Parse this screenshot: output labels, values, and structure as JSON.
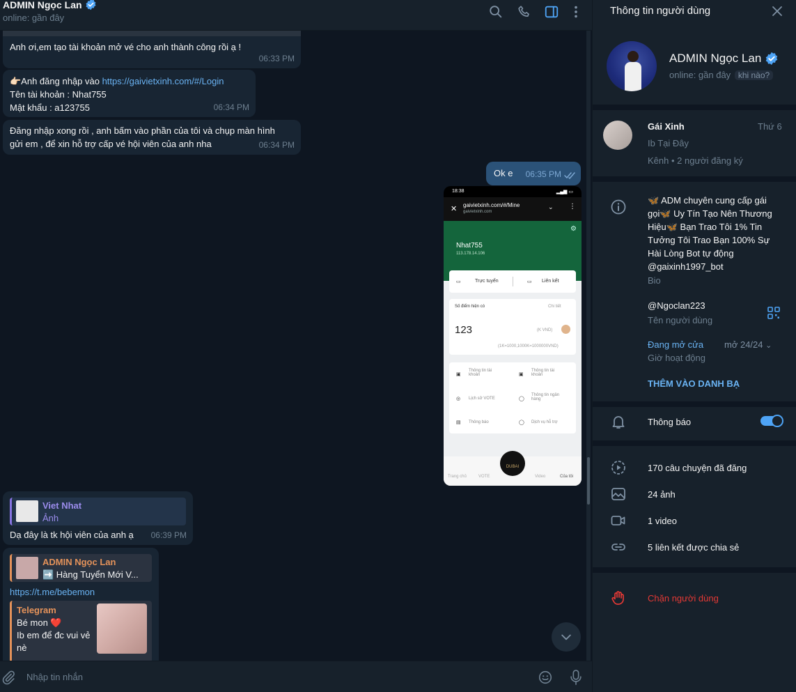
{
  "chat": {
    "title": "ADMIN Ngọc Lan",
    "status": "online: gần đây",
    "composer_placeholder": "Nhập tin nhắn"
  },
  "messages": {
    "m1": {
      "text": "Anh ơi,em tạo tài khoản mở vé cho anh thành công rồi ạ !",
      "time": "06:33 PM"
    },
    "m2": {
      "line1_prefix": "👉🏻Anh đăng nhập vào ",
      "line1_link": "https://gaivietxinh.com/#/Login",
      "line2": "Tên tài khoản : Nhat755",
      "line3": "Mật khẩu : a123755",
      "time": "06:34 PM"
    },
    "m3": {
      "line1": "Đăng nhập xong rồi , anh bấm vào phần của tôi và chụp màn hình",
      "line2": "gửi em , để xin hỗ trợ cấp vé hội viên của anh nha",
      "time": "06:34 PM"
    },
    "m4": {
      "text": "Ok e",
      "time": "06:35 PM"
    },
    "m5": {
      "reply_name": "Viet Nhat",
      "reply_text": "Ảnh",
      "text": "Dạ đây là tk hội viên của anh ạ",
      "time": "06:39 PM"
    },
    "m6": {
      "reply_name": "ADMIN Ngọc Lan",
      "reply_text": "➡️ Hàng Tuyển Mới V...",
      "link": "https://t.me/bebemon",
      "preview_site": "Telegram",
      "preview_title": "Bé mon ❤️",
      "preview_line1": "Ib em để đc vui vẻ",
      "preview_line2": "nè"
    }
  },
  "screenshot": {
    "clock": "18:38",
    "url": "gaivietxinh.com/#/Mine",
    "url_sub": "gaivietxinh.com",
    "username": "Nhat755",
    "ip": "113.178.14.106",
    "tab_online": "Trực tuyến",
    "tab_link": "Liên kết",
    "points_label": "Số điểm hiện có",
    "details": "Chi tiết",
    "points_value": "123",
    "points_unit": "(K VND)",
    "points_rate": "(1K=1000,1000K=1000000VND)",
    "menu": [
      "Thông tin tài khoản",
      "Thông tin tài khoản",
      "Lịch sử VOTE",
      "Thông tin ngân hàng",
      "Thông báo",
      "Dịch vụ hỗ trợ"
    ],
    "nav": [
      "Trang chủ",
      "VOTE",
      "DUBAI",
      "Video",
      "Của tôi"
    ]
  },
  "panel": {
    "title": "Thông tin người dùng",
    "name": "ADMIN Ngọc Lan",
    "status": "online: gần đây",
    "status_chip": "khi nào?",
    "channel": {
      "name": "Gái Xinh",
      "day": "Thứ 6",
      "desc": "Ib Tại Đây",
      "meta": "Kênh • 2 người đăng ký"
    },
    "bio": {
      "l1": "🦋 ADM chuyên cung cấp gái",
      "l2": "gọi🦋 Uy Tín Tạo Nên Thương",
      "l3": "Hiệu🦋 Bạn Trao Tôi 1% Tin",
      "l4": "Tưởng Tôi Trao Bạn 100% Sự",
      "l5": "Hài Lòng Bot tự động",
      "link": "@gaixinh1997_bot",
      "label": "Bio"
    },
    "username": {
      "value": "@Ngoclan223",
      "label": "Tên người dùng"
    },
    "hours": {
      "open": "Đang mở cửa",
      "range": "mở 24/24",
      "label": "Giờ hoạt động"
    },
    "add_contact": "THÊM VÀO DANH BẠ",
    "notifications": "Thông báo",
    "notifications_on": true,
    "media": {
      "stories": "170 câu chuyện đã đăng",
      "photos": "24 ảnh",
      "videos": "1 video",
      "links": "5 liên kết được chia sẻ"
    },
    "block": "Chặn người dùng"
  },
  "colors": {
    "accent": "#6ab3f3",
    "danger": "#e53935",
    "bubble_in": "#182533",
    "bubble_out": "#2b5278",
    "bg": "#0e1621",
    "panel": "#17212b"
  }
}
